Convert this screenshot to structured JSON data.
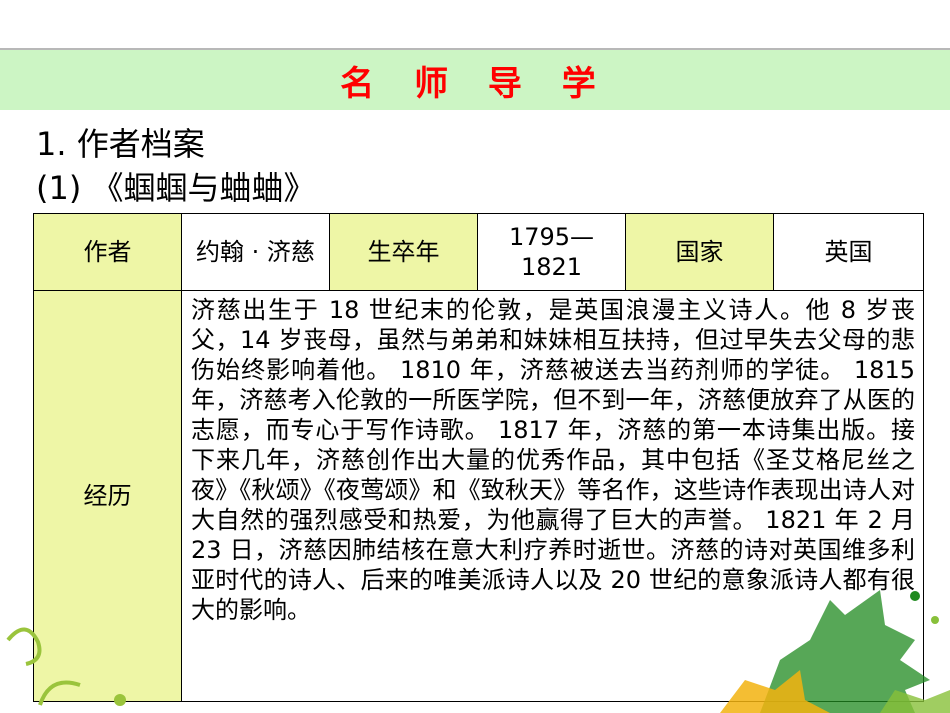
{
  "title": "名 师 导 学",
  "heading1": "1.  作者档案",
  "heading2": "(1) 《蝈蝈与蛐蛐》",
  "table": {
    "author_label": "作者",
    "author_value": "约翰 · 济慈",
    "years_label": "生卒年",
    "years_value": "1795—1821",
    "country_label": "国家",
    "country_value": "英国",
    "experience_label": "经历",
    "experience_text": "济慈出生于 18 世纪末的伦敦，是英国浪漫主义诗人。他 8 岁丧父，14 岁丧母，虽然与弟弟和妹妹相互扶持，但过早失去父母的悲伤始终影响着他。 1810 年，济慈被送去当药剂师的学徒。 1815 年，济慈考入伦敦的一所医学院，但不到一年，济慈便放弃了从医的志愿，而专心于写作诗歌。 1817 年，济慈的第一本诗集出版。接下来几年，济慈创作出大量的优秀作品，其中包括《圣艾格尼丝之夜》《秋颂》《夜莺颂》和《致秋天》等名作，这些诗作表现出诗人对大自然的强烈感受和热爱，为他赢得了巨大的声誉。 1821 年 2 月 23 日，济慈因肺结核在意大利疗养时逝世。济慈的诗对英国维多利亚时代的诗人、后来的唯美派诗人以及 20 世纪的意象派诗人都有很大的影响。"
  },
  "colors": {
    "title_bar": "#ccf5c4",
    "title_text": "#ff0000",
    "label_cell": "#eef6a6"
  }
}
